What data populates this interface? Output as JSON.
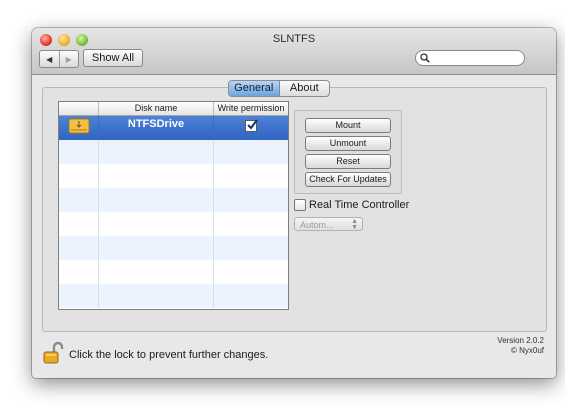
{
  "window": {
    "title": "SLNTFS",
    "show_all_label": "Show All",
    "search_placeholder": "",
    "back_glyph": "◀",
    "forward_glyph": "▶"
  },
  "tabs": [
    {
      "label": "General",
      "active": true
    },
    {
      "label": "About",
      "active": false
    }
  ],
  "table": {
    "columns": [
      "",
      "Disk name",
      "Write permission"
    ],
    "rows": [
      {
        "icon": "drive-icon",
        "disk_name": "NTFSDrive",
        "write_permission": true,
        "selected": true
      }
    ]
  },
  "actions": {
    "mount": "Mount",
    "unmount": "Unmount",
    "reset": "Reset",
    "check_updates": "Check For Updates"
  },
  "real_time_controller": {
    "label": "Real Time Controller",
    "checked": false
  },
  "mode_select": {
    "value": "Autom...",
    "enabled": false
  },
  "footer": {
    "lock_text": "Click the lock to prevent further changes.",
    "version": "Version 2.0.2",
    "copyright": "© Nyx0uf"
  },
  "colors": {
    "selection": "#3a6fcb",
    "accent_tab": "#6fa3dc"
  }
}
